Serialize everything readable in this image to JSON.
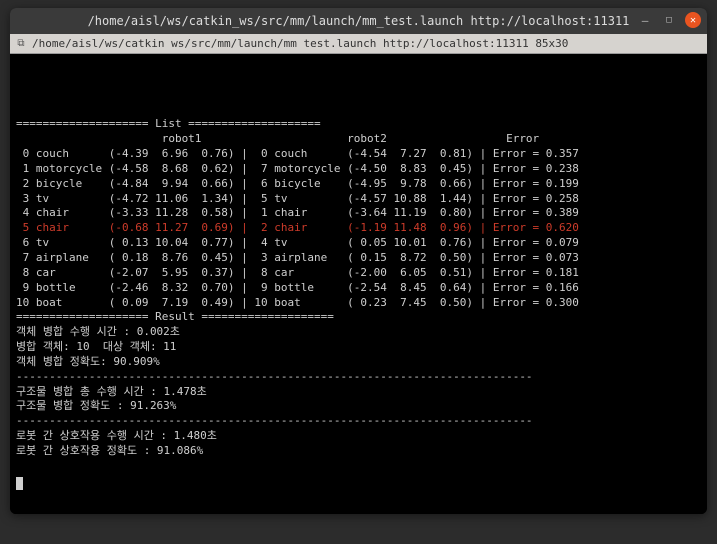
{
  "window": {
    "title": "/home/aisl/ws/catkin_ws/src/mm/launch/mm_test.launch http://localhost:11311",
    "tab_label": "/home/aisl/ws/catkin ws/src/mm/launch/mm test.launch http://localhost:11311 85x30"
  },
  "list_header": {
    "rule_left": "====================",
    "label": " List ",
    "rule_right": "===================="
  },
  "col_headers": {
    "r1": "robot1",
    "r2": "robot2",
    "err": "Error"
  },
  "rows": [
    {
      "idx": "0",
      "r1": {
        "name": "couch",
        "x": "-4.39",
        "y": "6.96",
        "z": "0.76"
      },
      "i2": "0",
      "r2": {
        "name": "couch",
        "x": "-4.54",
        "y": "7.27",
        "z": "0.81"
      },
      "err": "0.357",
      "hl": false
    },
    {
      "idx": "1",
      "r1": {
        "name": "motorcycle",
        "x": "-4.58",
        "y": "8.68",
        "z": "0.62"
      },
      "i2": "7",
      "r2": {
        "name": "motorcycle",
        "x": "-4.50",
        "y": "8.83",
        "z": "0.45"
      },
      "err": "0.238",
      "hl": false
    },
    {
      "idx": "2",
      "r1": {
        "name": "bicycle",
        "x": "-4.84",
        "y": "9.94",
        "z": "0.66"
      },
      "i2": "6",
      "r2": {
        "name": "bicycle",
        "x": "-4.95",
        "y": "9.78",
        "z": "0.66"
      },
      "err": "0.199",
      "hl": false
    },
    {
      "idx": "3",
      "r1": {
        "name": "tv",
        "x": "-4.72",
        "y": "11.06",
        "z": "1.34"
      },
      "i2": "5",
      "r2": {
        "name": "tv",
        "x": "-4.57",
        "y": "10.88",
        "z": "1.44"
      },
      "err": "0.258",
      "hl": false
    },
    {
      "idx": "4",
      "r1": {
        "name": "chair",
        "x": "-3.33",
        "y": "11.28",
        "z": "0.58"
      },
      "i2": "1",
      "r2": {
        "name": "chair",
        "x": "-3.64",
        "y": "11.19",
        "z": "0.80"
      },
      "err": "0.389",
      "hl": false
    },
    {
      "idx": "5",
      "r1": {
        "name": "chair",
        "x": "-0.68",
        "y": "11.27",
        "z": "0.69"
      },
      "i2": "2",
      "r2": {
        "name": "chair",
        "x": "-1.19",
        "y": "11.48",
        "z": "0.96"
      },
      "err": "0.620",
      "hl": true
    },
    {
      "idx": "6",
      "r1": {
        "name": "tv",
        "x": "0.13",
        "y": "10.04",
        "z": "0.77"
      },
      "i2": "4",
      "r2": {
        "name": "tv",
        "x": "0.05",
        "y": "10.01",
        "z": "0.76"
      },
      "err": "0.079",
      "hl": false
    },
    {
      "idx": "7",
      "r1": {
        "name": "airplane",
        "x": "0.18",
        "y": "8.76",
        "z": "0.45"
      },
      "i2": "3",
      "r2": {
        "name": "airplane",
        "x": "0.15",
        "y": "8.72",
        "z": "0.50"
      },
      "err": "0.073",
      "hl": false
    },
    {
      "idx": "8",
      "r1": {
        "name": "car",
        "x": "-2.07",
        "y": "5.95",
        "z": "0.37"
      },
      "i2": "8",
      "r2": {
        "name": "car",
        "x": "-2.00",
        "y": "6.05",
        "z": "0.51"
      },
      "err": "0.181",
      "hl": false
    },
    {
      "idx": "9",
      "r1": {
        "name": "bottle",
        "x": "-2.46",
        "y": "8.32",
        "z": "0.70"
      },
      "i2": "9",
      "r2": {
        "name": "bottle",
        "x": "-2.54",
        "y": "8.45",
        "z": "0.64"
      },
      "err": "0.166",
      "hl": false
    },
    {
      "idx": "10",
      "r1": {
        "name": "boat",
        "x": "0.09",
        "y": "7.19",
        "z": "0.49"
      },
      "i2": "10",
      "r2": {
        "name": "boat",
        "x": "0.23",
        "y": "7.45",
        "z": "0.50"
      },
      "err": "0.300",
      "hl": false
    }
  ],
  "result_header": {
    "rule_left": "====================",
    "label": " Result ",
    "rule_right": "===================="
  },
  "stats": {
    "obj_merge_time_label": "객체 병합 수행 시간 :",
    "obj_merge_time_value": "0.002초",
    "merged_label": "병합 객체:",
    "merged_value": "10",
    "target_label": "대상 객체:",
    "target_value": "11",
    "obj_merge_acc_label": "객체 병합 정확도:",
    "obj_merge_acc_value": "90.909%",
    "struct_merge_time_label": "구조물 병합 총 수행 시간 :",
    "struct_merge_time_value": "1.478초",
    "struct_merge_acc_label": "구조물 병합 정확도 :",
    "struct_merge_acc_value": "91.263%",
    "robot_interact_time_label": "로봇 간 상호작용 수행 시간 :",
    "robot_interact_time_value": "1.480초",
    "robot_interact_acc_label": "로봇 간 상호작용 정확도 :",
    "robot_interact_acc_value": "91.086%"
  },
  "dash_rule": "------------------------------------------------------------------------------"
}
